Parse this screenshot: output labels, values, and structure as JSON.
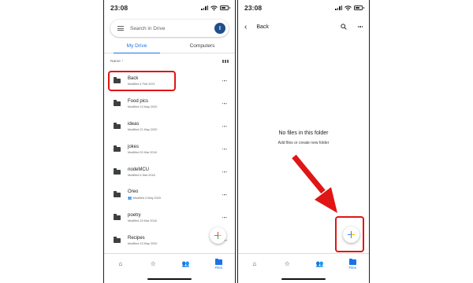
{
  "left_screen": {
    "status_time": "23:08",
    "search_placeholder": "Search in Drive",
    "avatar_initial": "I",
    "tabs": [
      {
        "label": "My Drive",
        "active": true
      },
      {
        "label": "Computers",
        "active": false
      }
    ],
    "sort_label": "Name",
    "sort_arrow": "↑",
    "files": [
      {
        "name": "Back",
        "meta": "Modified 4 Feb 2021",
        "shared": false,
        "highlighted": true
      },
      {
        "name": "Food pics",
        "meta": "Modified 13 May 2020",
        "shared": false
      },
      {
        "name": "ideas",
        "meta": "Modified 21 May 2020",
        "shared": false
      },
      {
        "name": "jokes",
        "meta": "Modified 20 Mar 2018",
        "shared": false
      },
      {
        "name": "nodeMCU",
        "meta": "Modified 5 Mar 2018",
        "shared": false
      },
      {
        "name": "Oreo",
        "meta": "Modified 4 May 2020",
        "shared": true
      },
      {
        "name": "poetry",
        "meta": "Modified 15 Mar 2018",
        "shared": false
      },
      {
        "name": "Recipes",
        "meta": "Modified 13 May 2020",
        "shared": false
      }
    ],
    "bottom_nav": {
      "files_label": "Files"
    }
  },
  "right_screen": {
    "status_time": "23:08",
    "folder_title": "Back",
    "empty_title": "No files in this folder",
    "empty_subtitle": "Add files or create new folder",
    "bottom_nav": {
      "files_label": "Files"
    }
  },
  "colors": {
    "accent": "#1a73e8",
    "highlight": "#e01515",
    "avatar": "#1f4e8c"
  }
}
